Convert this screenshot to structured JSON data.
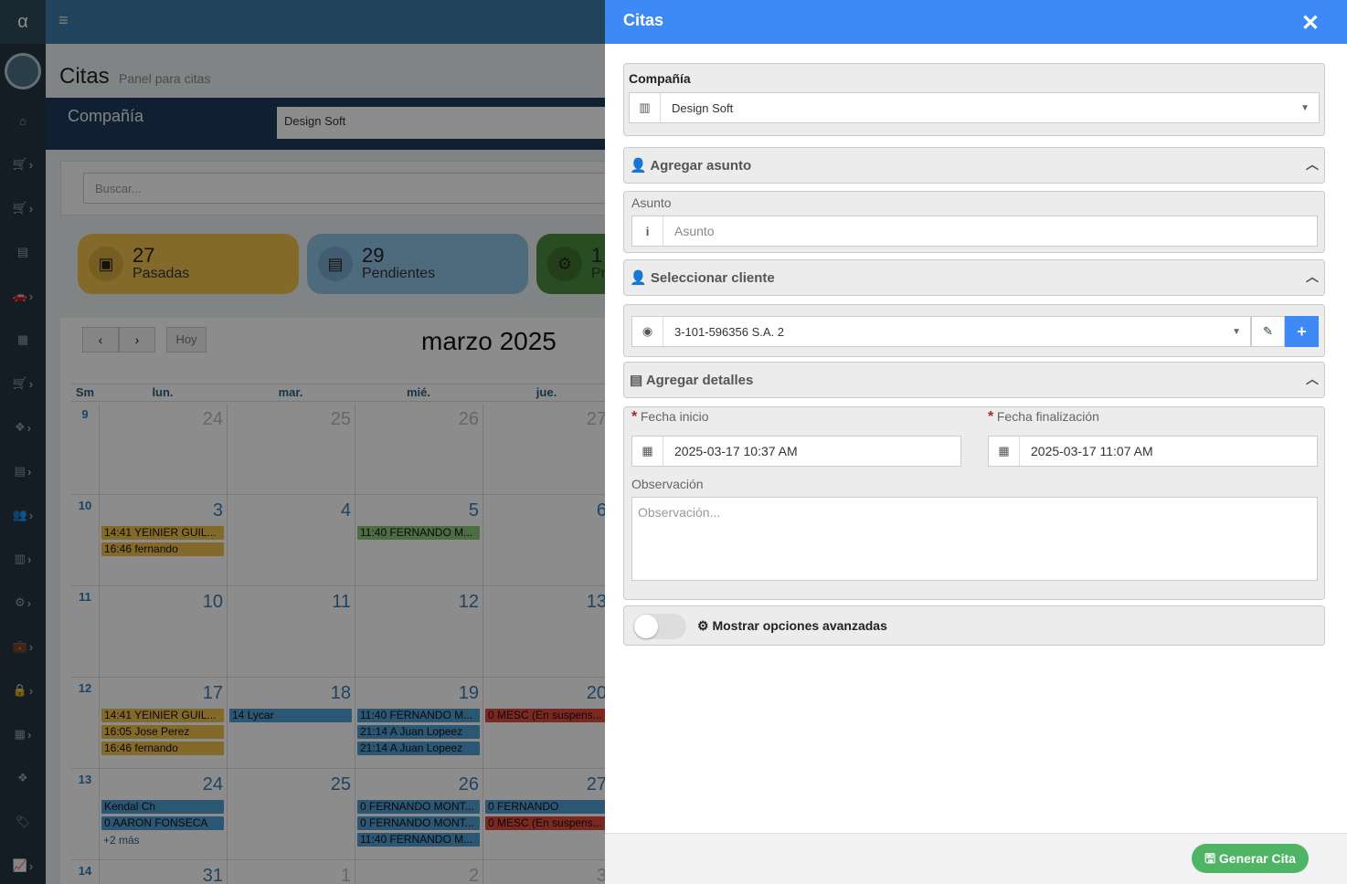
{
  "sidebar": {
    "brand": "α",
    "icons": [
      "home-icon",
      "cart-icon",
      "cart-icon",
      "file-icon",
      "car-icon",
      "calendar-icon",
      "cart-icon",
      "cubes-icon",
      "file-icon",
      "users-icon",
      "bar-chart-icon",
      "gear-icon",
      "briefcase-icon",
      "lock-icon",
      "calculator-icon",
      "cubes-icon",
      "tags-icon",
      "line-chart-icon"
    ]
  },
  "background": {
    "title": "Citas",
    "subtitle": "Panel para citas",
    "company_label": "Compañía",
    "company_value": "Design Soft",
    "search_placeholder": "Buscar...",
    "stats": [
      {
        "number": "27",
        "label": "Pasadas",
        "color": "#f0c24e"
      },
      {
        "number": "29",
        "label": "Pendientes",
        "color": "#8fc1e4"
      },
      {
        "number": "1",
        "label": "Pr",
        "color": "#4e8a3e"
      }
    ],
    "calendar": {
      "prev": "‹",
      "next": "›",
      "today": "Hoy",
      "month_title": "marzo 2025",
      "headers": [
        "Sm",
        "lun.",
        "mar.",
        "mié.",
        "jue."
      ],
      "weeks": [
        {
          "num": "9",
          "days": [
            "24",
            "25",
            "26",
            "27"
          ]
        },
        {
          "num": "10",
          "days": [
            "3",
            "4",
            "5",
            "6"
          ]
        },
        {
          "num": "11",
          "days": [
            "10",
            "11",
            "12",
            "13"
          ]
        },
        {
          "num": "12",
          "days": [
            "17",
            "18",
            "19",
            "20"
          ]
        },
        {
          "num": "13",
          "days": [
            "24",
            "25",
            "26",
            "27"
          ]
        },
        {
          "num": "14",
          "days": [
            "31",
            "1",
            "2",
            "3"
          ]
        }
      ],
      "events": {
        "w10_mon": [
          "14:41 YEINIER GUIL...",
          "16:46 fernando"
        ],
        "w10_wed": [
          "11:40 FERNANDO M..."
        ],
        "w12_mon": [
          "14:41 YEINIER GUIL...",
          "16:05 Jose Perez",
          "16:46 fernando"
        ],
        "w12_tue": [
          "14 Lycar"
        ],
        "w12_wed": [
          "11:40 FERNANDO M...",
          "21:14 A Juan Lopeez",
          "21:14 A Juan Lopeez"
        ],
        "w12_thu": [
          "0 MESC (En suspens..."
        ],
        "w13_mon": [
          "Kendal Ch",
          "0 AARON FONSECA"
        ],
        "w13_mon_more": "+2 más",
        "w13_wed": [
          "0 FERNANDO MONT...",
          "0 FERNANDO MONT...",
          "11:40 FERNANDO M..."
        ],
        "w13_thu": [
          "0 FERNANDO",
          "0 MESC (En suspens..."
        ]
      }
    }
  },
  "panel": {
    "title": "Citas",
    "company": {
      "label": "Compañía",
      "value": "Design Soft"
    },
    "subject_section": "Agregar asunto",
    "subject": {
      "label": "Asunto",
      "placeholder": "Asunto"
    },
    "client_section": "Seleccionar cliente",
    "client": {
      "value": "3-101-596356 S.A. 2"
    },
    "details_section": "Agregar detalles",
    "start": {
      "label": "Fecha inicio",
      "value": "2025-03-17 10:37 AM"
    },
    "end": {
      "label": "Fecha finalización",
      "value": "2025-03-17 11:07 AM"
    },
    "observation": {
      "label": "Observación",
      "placeholder": "Observación..."
    },
    "advanced_label": "Mostrar opciones avanzadas",
    "submit": "Generar Cita"
  }
}
